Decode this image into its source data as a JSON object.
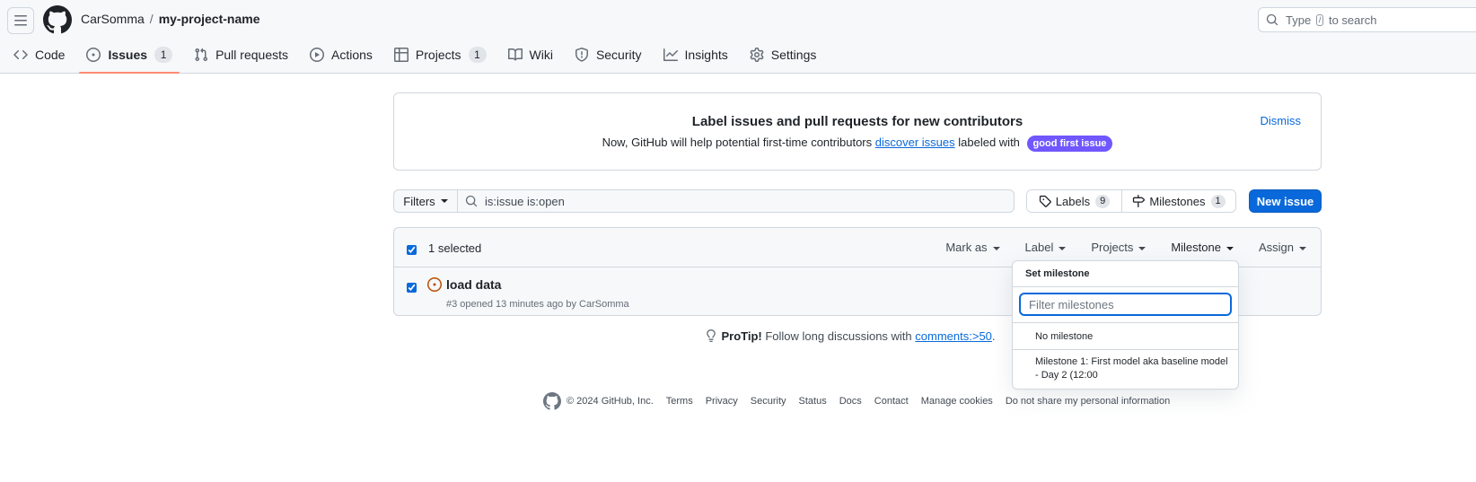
{
  "header": {
    "owner": "CarSomma",
    "separator": "/",
    "repo": "my-project-name",
    "search": {
      "before": "Type",
      "key": "/",
      "after": "to search"
    }
  },
  "nav": {
    "tabs": [
      {
        "label": "Code",
        "icon": "code-icon"
      },
      {
        "label": "Issues",
        "icon": "issue-opened-icon",
        "count": "1",
        "selected": true
      },
      {
        "label": "Pull requests",
        "icon": "git-pull-request-icon"
      },
      {
        "label": "Actions",
        "icon": "play-icon"
      },
      {
        "label": "Projects",
        "icon": "table-icon",
        "count": "1"
      },
      {
        "label": "Wiki",
        "icon": "book-icon"
      },
      {
        "label": "Security",
        "icon": "shield-icon"
      },
      {
        "label": "Insights",
        "icon": "graph-icon"
      },
      {
        "label": "Settings",
        "icon": "gear-icon"
      }
    ]
  },
  "banner": {
    "title": "Label issues and pull requests for new contributors",
    "text_before": "Now, GitHub will help potential first-time contributors",
    "link": "discover issues",
    "text_after": "labeled with",
    "label": "good first issue",
    "label_color": "#7057ff",
    "dismiss": "Dismiss"
  },
  "filters": {
    "button": "Filters",
    "query": "is:issue is:open"
  },
  "labels_button": {
    "label": "Labels",
    "count": "9"
  },
  "milestones_button": {
    "label": "Milestones",
    "count": "1"
  },
  "new_issue": "New issue",
  "issues": {
    "selected_text": "1 selected",
    "bulk_actions": [
      "Mark as",
      "Label",
      "Projects",
      "Milestone",
      "Assign"
    ],
    "items": [
      {
        "title": "load data",
        "meta": "#3 opened 13 minutes ago by",
        "author": "CarSomma",
        "checked": true
      }
    ]
  },
  "milestone_menu": {
    "title": "Set milestone",
    "filter_placeholder": "Filter milestones",
    "items": [
      "No milestone",
      "Milestone 1: First model aka baseline model - Day 2 (12:00"
    ]
  },
  "protip": {
    "label": "ProTip!",
    "text": "Follow long discussions with",
    "link": "comments:>50",
    "end": "."
  },
  "footer": {
    "copyright": "© 2024 GitHub, Inc.",
    "links": [
      "Terms",
      "Privacy",
      "Security",
      "Status",
      "Docs",
      "Contact",
      "Manage cookies",
      "Do not share my personal information"
    ]
  },
  "colors": {
    "accent": "#0969da",
    "selected_tab_underline": "#fd8c73",
    "issue_open_icon": "#bc4c00"
  }
}
